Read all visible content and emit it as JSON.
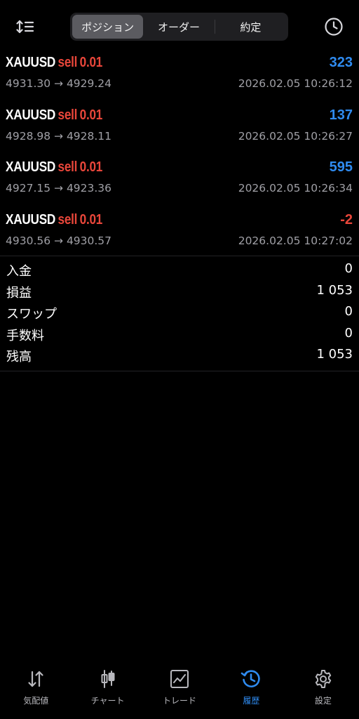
{
  "header": {
    "tabs": [
      {
        "label": "ポジション",
        "active": true
      },
      {
        "label": "オーダー",
        "active": false
      },
      {
        "label": "約定",
        "active": false
      }
    ],
    "sort_icon": "sort-arrows-icon",
    "history_icon": "clock-icon"
  },
  "trades": [
    {
      "symbol": "XAUUSD",
      "side": "sell",
      "volume": "0.01",
      "profit": "323",
      "prices": "4931.30 → 4929.24",
      "time": "2026.02.05 10:26:12"
    },
    {
      "symbol": "XAUUSD",
      "side": "sell",
      "volume": "0.01",
      "profit": "137",
      "prices": "4928.98 → 4928.11",
      "time": "2026.02.05 10:26:27"
    },
    {
      "symbol": "XAUUSD",
      "side": "sell",
      "volume": "0.01",
      "profit": "595",
      "prices": "4927.15 → 4923.36",
      "time": "2026.02.05 10:26:34"
    },
    {
      "symbol": "XAUUSD",
      "side": "sell",
      "volume": "0.01",
      "profit": "-2",
      "prices": "4930.56 → 4930.57",
      "time": "2026.02.05 10:27:02"
    }
  ],
  "summary": [
    {
      "label": "入金",
      "value": "0"
    },
    {
      "label": "損益",
      "value": "1 053"
    },
    {
      "label": "スワップ",
      "value": "0"
    },
    {
      "label": "手数料",
      "value": "0"
    },
    {
      "label": "残高",
      "value": "1 053"
    }
  ],
  "nav": [
    {
      "label": "気配値",
      "icon": "quotes-arrows-icon",
      "active": false
    },
    {
      "label": "チャート",
      "icon": "candlestick-icon",
      "active": false
    },
    {
      "label": "トレード",
      "icon": "trade-chart-icon",
      "active": false
    },
    {
      "label": "履歴",
      "icon": "history-icon",
      "active": true
    },
    {
      "label": "設定",
      "icon": "gear-icon",
      "active": false
    }
  ],
  "colors": {
    "profit_positive": "#2f8bf0",
    "profit_negative": "#e8463a",
    "sell": "#e8463a",
    "active_nav": "#2f8bf0",
    "background": "#000000"
  }
}
